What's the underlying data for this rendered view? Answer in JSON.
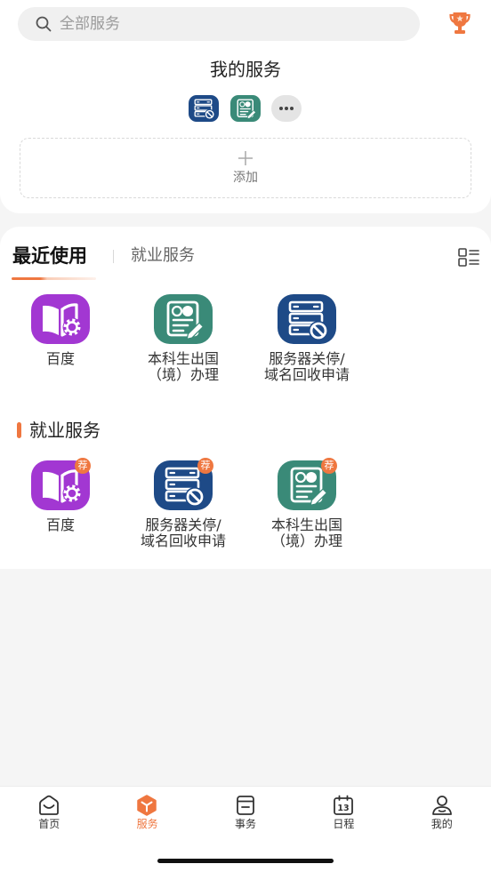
{
  "icons": {
    "search": "search-icon",
    "trophy": "trophy-icon",
    "view_toggle": "list-view-icon",
    "more": "more-icon",
    "add": "plus-icon"
  },
  "colors": {
    "accent": "#ef7740",
    "page_background": "#f5f5f5",
    "card_background": "#ffffff"
  },
  "search": {
    "placeholder": "全部服务"
  },
  "my_services": {
    "title": "我的服务",
    "items": [
      {
        "icon": "server-block",
        "color": "#1e4a87"
      },
      {
        "icon": "certificate",
        "color": "#3a8a78"
      }
    ],
    "add_label": "添加"
  },
  "tabs": [
    {
      "label": "最近使用",
      "active": true
    },
    {
      "label": "就业服务",
      "active": false
    }
  ],
  "recent_apps": [
    {
      "lines": [
        "百度"
      ],
      "icon": "book-gear",
      "color": "#a237d2"
    },
    {
      "lines": [
        "本科生出国",
        "（境）办理"
      ],
      "icon": "certificate",
      "color": "#3a8a78"
    },
    {
      "lines": [
        "服务器关停/",
        "域名回收申请"
      ],
      "icon": "server-block",
      "color": "#1e4a87"
    }
  ],
  "employment_section": {
    "title": "就业服务",
    "apps": [
      {
        "lines": [
          "百度"
        ],
        "icon": "book-gear",
        "color": "#a237d2",
        "badge": "荐"
      },
      {
        "lines": [
          "服务器关停/",
          "域名回收申请"
        ],
        "icon": "server-block",
        "color": "#1e4a87",
        "badge": "荐"
      },
      {
        "lines": [
          "本科生出国",
          "（境）办理"
        ],
        "icon": "certificate",
        "color": "#3a8a78",
        "badge": "荐"
      }
    ]
  },
  "bottom_nav": [
    {
      "label": "首页",
      "icon": "home-icon",
      "active": false
    },
    {
      "label": "服务",
      "icon": "services-icon",
      "active": true
    },
    {
      "label": "事务",
      "icon": "affairs-icon",
      "active": false
    },
    {
      "label": "日程",
      "icon": "calendar-icon",
      "icon_text": "13",
      "active": false
    },
    {
      "label": "我的",
      "icon": "profile-icon",
      "active": false
    }
  ]
}
